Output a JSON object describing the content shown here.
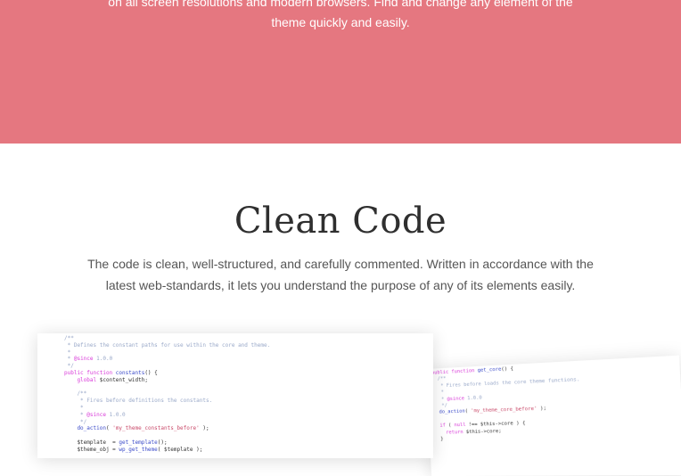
{
  "hero": {
    "text_line1": "on all screen resolutions and modern browsers. Find and change any element of the",
    "text_line2": "theme quickly and easily.",
    "background_color": "#e57780"
  },
  "section": {
    "title": "Clean Code",
    "desc_line1": "The code is clean, well-structured, and carefully commented. Written in accordance with the",
    "desc_line2": "latest web-standards, it lets you understand the purpose of any of its elements easily."
  },
  "colors": {
    "comment": "#9aa9c9",
    "keyword": "#d83ad8",
    "function": "#3a4ac9",
    "text": "#333333",
    "string": "#c94a6a",
    "tag": "#2e9c5a"
  },
  "code_primary": [
    [
      {
        "t": "/**",
        "c": "comment"
      }
    ],
    [
      {
        "t": " * Defines the constant paths for use within the core and theme.",
        "c": "comment"
      }
    ],
    [
      {
        "t": " *",
        "c": "comment"
      }
    ],
    [
      {
        "t": " * ",
        "c": "comment"
      },
      {
        "t": "@since",
        "c": "keyword"
      },
      {
        "t": " 1.0.0",
        "c": "comment"
      }
    ],
    [
      {
        "t": " */",
        "c": "comment"
      }
    ],
    [
      {
        "t": "public function ",
        "c": "keyword"
      },
      {
        "t": "constants",
        "c": "function"
      },
      {
        "t": "() {",
        "c": "text"
      }
    ],
    [
      {
        "t": "    global ",
        "c": "keyword"
      },
      {
        "t": "$content_width;",
        "c": "text"
      }
    ],
    [
      {
        "t": "",
        "c": "text"
      }
    ],
    [
      {
        "t": "    /**",
        "c": "comment"
      }
    ],
    [
      {
        "t": "     * Fires before definitions the constants.",
        "c": "comment"
      }
    ],
    [
      {
        "t": "     *",
        "c": "comment"
      }
    ],
    [
      {
        "t": "     * ",
        "c": "comment"
      },
      {
        "t": "@since",
        "c": "keyword"
      },
      {
        "t": " 1.0.0",
        "c": "comment"
      }
    ],
    [
      {
        "t": "     */",
        "c": "comment"
      }
    ],
    [
      {
        "t": "    do_action",
        "c": "function"
      },
      {
        "t": "( ",
        "c": "text"
      },
      {
        "t": "'my_theme_constants_before'",
        "c": "string"
      },
      {
        "t": " );",
        "c": "text"
      }
    ],
    [
      {
        "t": "",
        "c": "text"
      }
    ],
    [
      {
        "t": "    $template  = ",
        "c": "text"
      },
      {
        "t": "get_template",
        "c": "function"
      },
      {
        "t": "();",
        "c": "text"
      }
    ],
    [
      {
        "t": "    $theme_obj = ",
        "c": "text"
      },
      {
        "t": "wp_get_theme",
        "c": "function"
      },
      {
        "t": "( $template );",
        "c": "text"
      }
    ]
  ],
  "code_secondary": [
    [
      {
        "t": "public function ",
        "c": "keyword"
      },
      {
        "t": "get_core",
        "c": "function"
      },
      {
        "t": "() {",
        "c": "text"
      }
    ],
    [
      {
        "t": "  /**",
        "c": "comment"
      }
    ],
    [
      {
        "t": "   * Fires before loads the core theme functions.",
        "c": "comment"
      }
    ],
    [
      {
        "t": "   *",
        "c": "comment"
      }
    ],
    [
      {
        "t": "   * ",
        "c": "comment"
      },
      {
        "t": "@since",
        "c": "keyword"
      },
      {
        "t": " 1.0.0",
        "c": "comment"
      }
    ],
    [
      {
        "t": "   */",
        "c": "comment"
      }
    ],
    [
      {
        "t": "  do_action",
        "c": "function"
      },
      {
        "t": "( ",
        "c": "text"
      },
      {
        "t": "'my_theme_core_before'",
        "c": "string"
      },
      {
        "t": " );",
        "c": "text"
      }
    ],
    [
      {
        "t": "",
        "c": "text"
      }
    ],
    [
      {
        "t": "  if ",
        "c": "keyword"
      },
      {
        "t": "( ",
        "c": "text"
      },
      {
        "t": "null",
        "c": "keyword"
      },
      {
        "t": " !== $this->core ) {",
        "c": "text"
      }
    ],
    [
      {
        "t": "    return ",
        "c": "keyword"
      },
      {
        "t": "$this->core;",
        "c": "text"
      }
    ],
    [
      {
        "t": "  }",
        "c": "text"
      }
    ]
  ]
}
